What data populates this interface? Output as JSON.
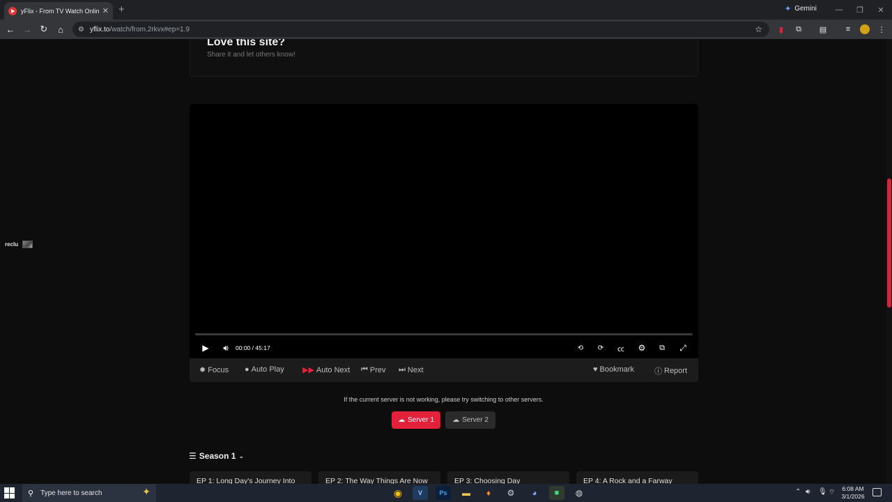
{
  "browser": {
    "tab_title": "yFlix - From TV Watch Online F",
    "new_tab_icon": "plus-icon",
    "gemini_label": "Gemini",
    "url_host": "yflix.to",
    "url_path": "/watch/from.2rkvx#ep=1.9"
  },
  "share": {
    "title": "Love this site?",
    "subtitle": "Share it and let others know!"
  },
  "player": {
    "current_time": "00:00",
    "separator": "/",
    "duration": "45:17",
    "progress": 0
  },
  "actions": {
    "focus": "Focus",
    "auto_play": "Auto Play",
    "auto_next": "Auto Next",
    "prev": "Prev",
    "next": "Next",
    "bookmark": "Bookmark",
    "report": "Report"
  },
  "servers": {
    "note": "If the current server is not working, please try switching to other servers.",
    "items": [
      {
        "label": "Server 1",
        "active": true
      },
      {
        "label": "Server 2",
        "active": false
      }
    ]
  },
  "season": {
    "label": "Season 1",
    "episodes": [
      {
        "label": "EP 1: Long Day's Journey Into"
      },
      {
        "label": "EP 2: The Way Things Are Now"
      },
      {
        "label": "EP 3: Choosing Day"
      },
      {
        "label": "EP 4: A Rock and a Farway"
      }
    ]
  },
  "side_widget": {
    "label": "reclu"
  },
  "taskbar": {
    "search_placeholder": "Type here to search",
    "time": "6:08 AM",
    "date": "3/1/2026"
  },
  "colors": {
    "accent": "#e3213a",
    "page_bg": "#0d0d0d",
    "player_bg": "#000000",
    "action_bar_bg": "#1c1c1c"
  }
}
